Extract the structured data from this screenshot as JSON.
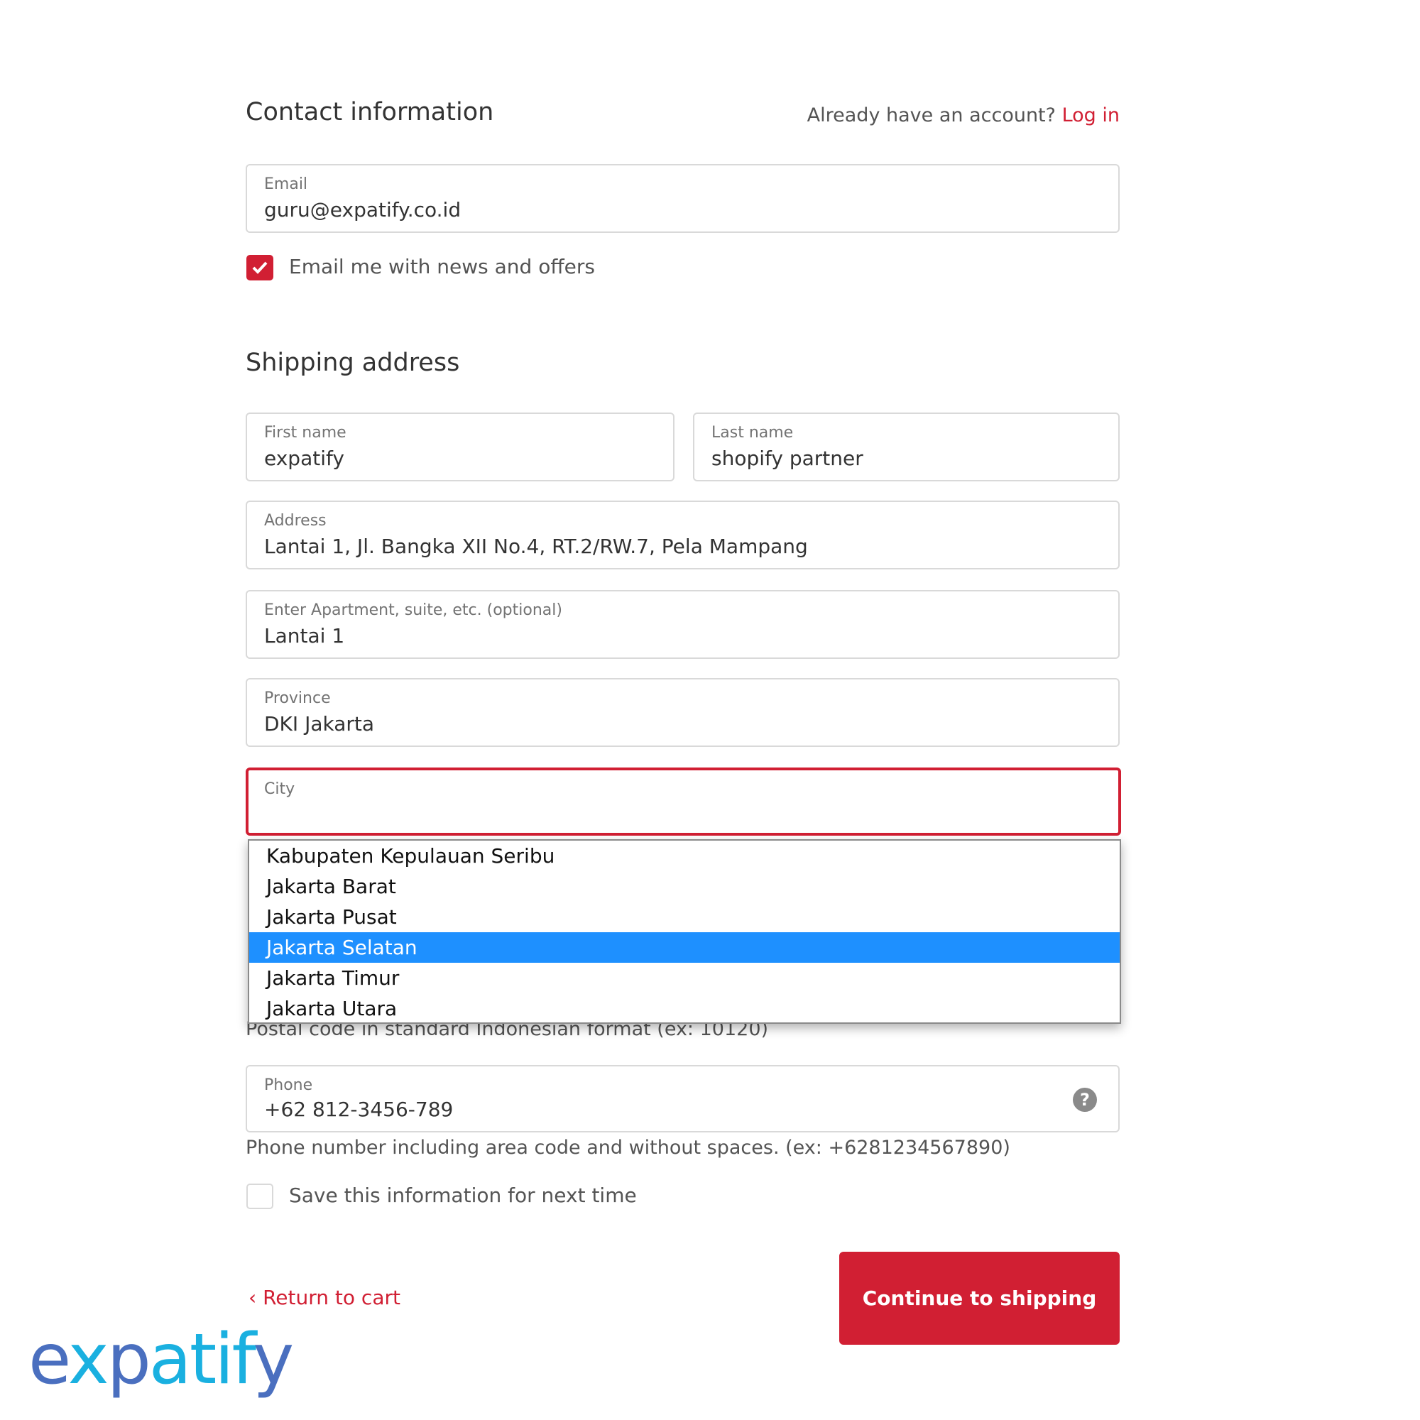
{
  "contact": {
    "title": "Contact information",
    "account_prompt": "Already have an account?",
    "login_link": "Log in",
    "email_label": "Email",
    "email_value": "guru@expatify.co.id",
    "newsletter_label": "Email me with news and offers",
    "newsletter_checked": true
  },
  "shipping": {
    "title": "Shipping address",
    "first_name_label": "First name",
    "first_name_value": "expatify",
    "last_name_label": "Last name",
    "last_name_value": "shopify partner",
    "address_label": "Address",
    "address_value": "Lantai 1, Jl. Bangka XII No.4, RT.2/RW.7, Pela Mampang",
    "apartment_label": "Enter Apartment, suite, etc. (optional)",
    "apartment_value": "Lantai 1",
    "province_label": "Province",
    "province_value": "DKI Jakarta",
    "city_label": "City",
    "city_options": [
      "Kabupaten Kepulauan Seribu",
      "Jakarta Barat",
      "Jakarta Pusat",
      "Jakarta Selatan",
      "Jakarta Timur",
      "Jakarta Utara"
    ],
    "city_highlighted": "Jakarta Selatan",
    "postal_help": "Postal code in standard Indonesian format (ex: 10120)",
    "phone_label": "Phone",
    "phone_value": "+62 812-3456-789",
    "phone_help": "Phone number including area code and without spaces. (ex: +6281234567890)",
    "save_info_label": "Save this information for next time",
    "save_info_checked": false
  },
  "footer": {
    "return_link": "Return to cart",
    "continue_button": "Continue to shipping"
  },
  "logo": {
    "text": "expatify"
  },
  "colors": {
    "accent": "#d11f33",
    "highlight": "#1e90ff",
    "logo_cyan": "#1ab0e0",
    "logo_blue": "#4a6fbf"
  }
}
